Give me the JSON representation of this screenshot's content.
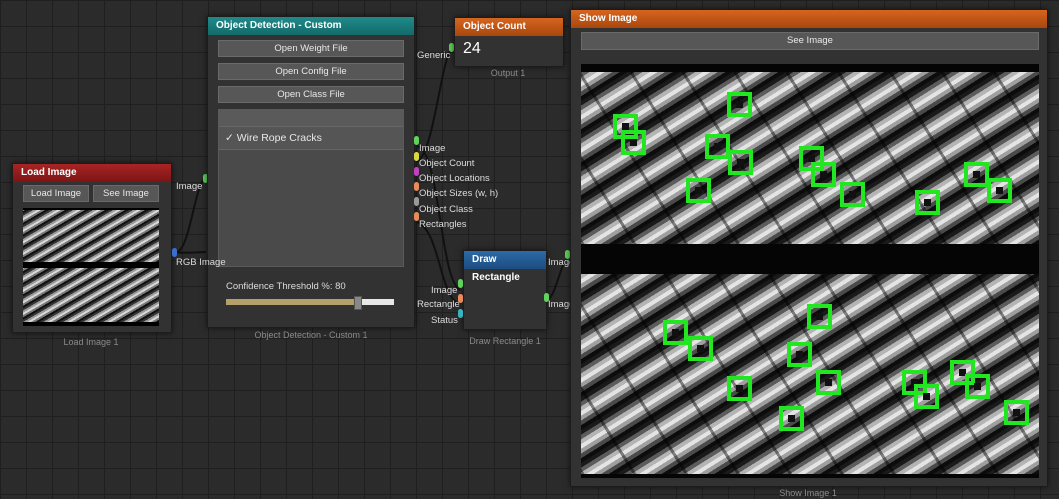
{
  "load_image": {
    "title": "Load Image",
    "load_button": "Load Image",
    "see_button": "See Image",
    "output_label": "Image",
    "caption": "Load Image 1"
  },
  "object_detection": {
    "title": "Object Detection - Custom",
    "buttons": [
      "Open Weight File",
      "Open Config File",
      "Open Class File"
    ],
    "class_item": "✓ Wire Rope Cracks",
    "input_label": "RGB Image",
    "generic_label": "Generic",
    "outputs": [
      "Image",
      "Object Count",
      "Object Locations",
      "Object Sizes (w, h)",
      "Object Class",
      "Rectangles"
    ],
    "confidence_label": "Confidence Threshold %: 80",
    "confidence_value": 80,
    "caption": "Object Detection - Custom 1"
  },
  "object_count": {
    "title": "Object Count",
    "value": "24",
    "caption": "Output 1"
  },
  "draw_rectangle": {
    "title": "Draw Rectangle",
    "inputs": [
      "Image",
      "Rectangle",
      "Status"
    ],
    "output_label": "Image",
    "caption": "Draw Rectangle 1"
  },
  "show_image": {
    "title": "Show Image",
    "see_button": "See Image",
    "caption": "Show Image 1"
  },
  "colors": {
    "detection_box": "#22e622",
    "red_header": "#a82424",
    "teal_header": "#1f8a8a",
    "orange_header": "#d5651e",
    "blue_header": "#2c6aa8"
  }
}
